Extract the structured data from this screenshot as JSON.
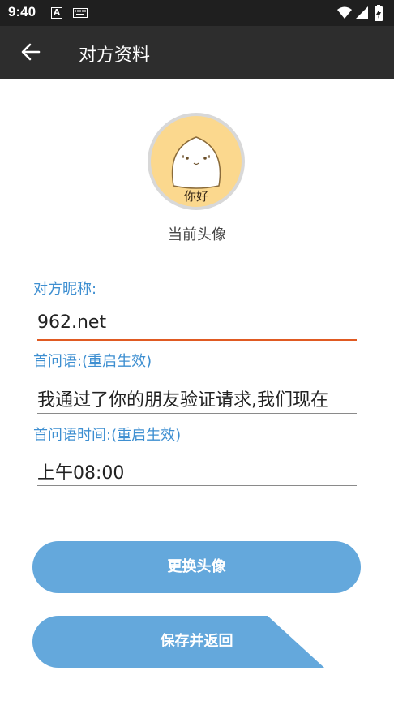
{
  "status_bar": {
    "time": "9:40",
    "notification_icon": "A"
  },
  "header": {
    "title": "对方资料",
    "back_icon": "arrow-left-icon"
  },
  "avatar": {
    "caption": "当前头像",
    "image_text": "你好"
  },
  "fields": [
    {
      "label": "对方昵称:",
      "value": "962.net"
    },
    {
      "label": "首问语:(重启生效)",
      "value": "我通过了你的朋友验证请求,我们现在"
    },
    {
      "label": "首问语时间:(重启生效)",
      "value": "上午08:00"
    }
  ],
  "buttons": {
    "change_avatar": "更换头像",
    "save_return": "保存并返回"
  },
  "colors": {
    "accent": "#3e8fd1",
    "button": "#64a8dc",
    "focus_line": "#e05a22",
    "app_bar": "#2d2d2d"
  }
}
